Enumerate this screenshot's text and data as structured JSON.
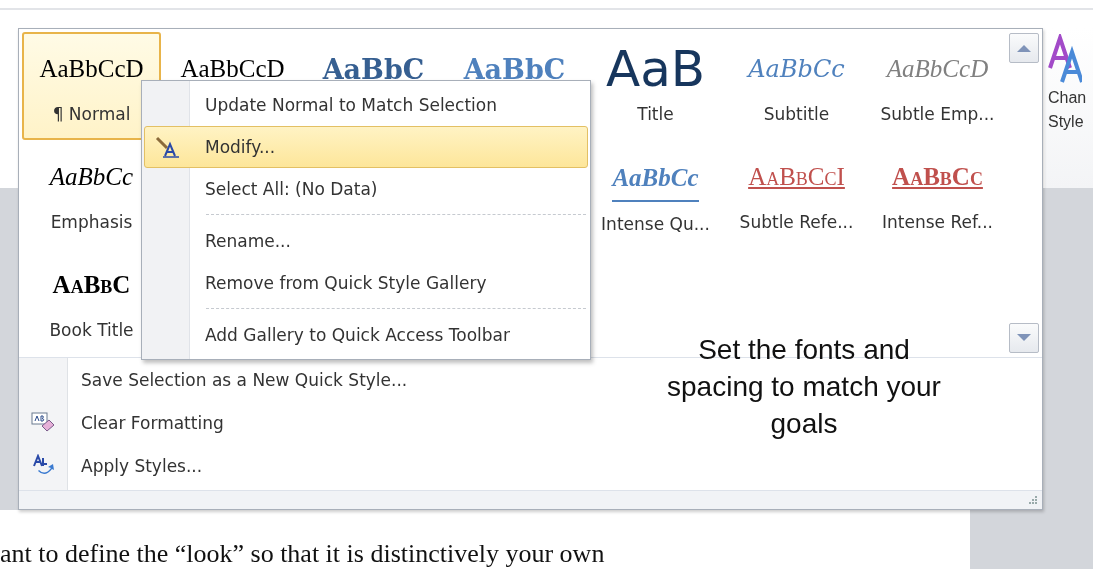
{
  "gallery": {
    "styles": [
      {
        "kind": "normal",
        "preview": "AaBbCcD",
        "label": "¶ Normal",
        "selected": true
      },
      {
        "kind": "no-spacing",
        "preview": "AaBbCcD",
        "selected": false
      },
      {
        "kind": "heading1",
        "preview": "AaBbC",
        "selected": false
      },
      {
        "kind": "heading2",
        "preview": "AaBbC",
        "selected": false
      },
      {
        "kind": "title",
        "preview": "AaB",
        "label": "Title",
        "selected": false
      },
      {
        "kind": "subtitle",
        "preview": "AaBbCc",
        "label": "Subtitle",
        "selected": false
      },
      {
        "kind": "subtle-emphasis",
        "preview": "AaBbCcD",
        "label": "Subtle Emp...",
        "selected": false
      },
      {
        "kind": "emphasis",
        "preview": "AaBbCc",
        "label": "Emphasis",
        "selected": false
      },
      {
        "kind": "covered"
      },
      {
        "kind": "covered"
      },
      {
        "kind": "covered"
      },
      {
        "kind": "intense-quote",
        "preview": "AaBbCc",
        "label": "Intense Qu...",
        "selected": false
      },
      {
        "kind": "subtle-reference",
        "preview": "AaBbCcI",
        "label": "Subtle Refe...",
        "selected": false
      },
      {
        "kind": "intense-reference",
        "preview": "AaBbCc",
        "label": "Intense Ref...",
        "selected": false
      },
      {
        "kind": "book-title",
        "preview": "AaBbC",
        "label": "Book Title",
        "selected": false
      }
    ],
    "commands": [
      {
        "label": "Save Selection as a New Quick Style..."
      },
      {
        "label": "Clear Formatting"
      },
      {
        "label": "Apply Styles..."
      }
    ]
  },
  "context_menu": {
    "items": [
      {
        "kind": "item",
        "label": "Update Normal to Match Selection",
        "selected": false
      },
      {
        "kind": "item",
        "label": "Modify...",
        "selected": true
      },
      {
        "kind": "item",
        "label": "Select All: (No Data)",
        "selected": false
      },
      {
        "kind": "separator"
      },
      {
        "kind": "item",
        "label": "Rename...",
        "selected": false
      },
      {
        "kind": "item",
        "label": "Remove from Quick Style Gallery",
        "selected": false
      },
      {
        "kind": "separator"
      },
      {
        "kind": "item",
        "label": "Add Gallery to Quick Access Toolbar",
        "selected": false
      }
    ]
  },
  "callout": "Set the fonts and spacing to match your goals",
  "change_styles": {
    "label_lines": [
      "Chan",
      "Style"
    ]
  },
  "document": {
    "text": "ant to define the “look” so that it is distinctively your own"
  }
}
